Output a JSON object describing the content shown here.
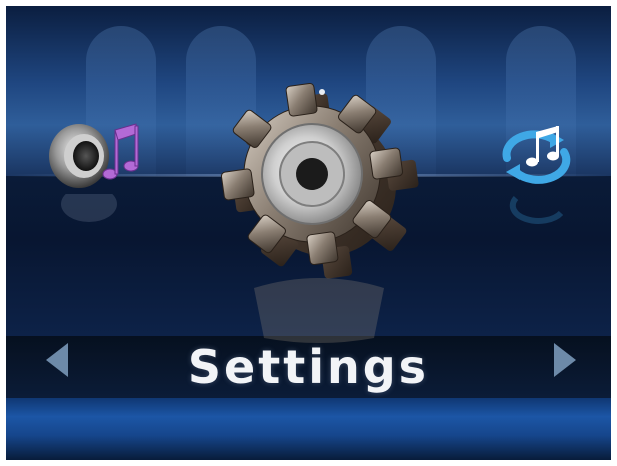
{
  "menu": {
    "current_item_label": "Settings",
    "items": [
      {
        "icon": "speaker-music-icon"
      },
      {
        "icon": "gear-icon"
      },
      {
        "icon": "sync-music-icon"
      }
    ],
    "prev_icon": "triangle-left-icon",
    "next_icon": "triangle-right-icon"
  },
  "colors": {
    "background_dark": "#0a1a36",
    "background_band": "#24497d",
    "bottom_band": "#1c56a6",
    "arrow": "#6d8aa9",
    "title_text": "#f2f4f7",
    "music_accent": "#b36ad6",
    "sync_accent": "#3fa8e6"
  }
}
